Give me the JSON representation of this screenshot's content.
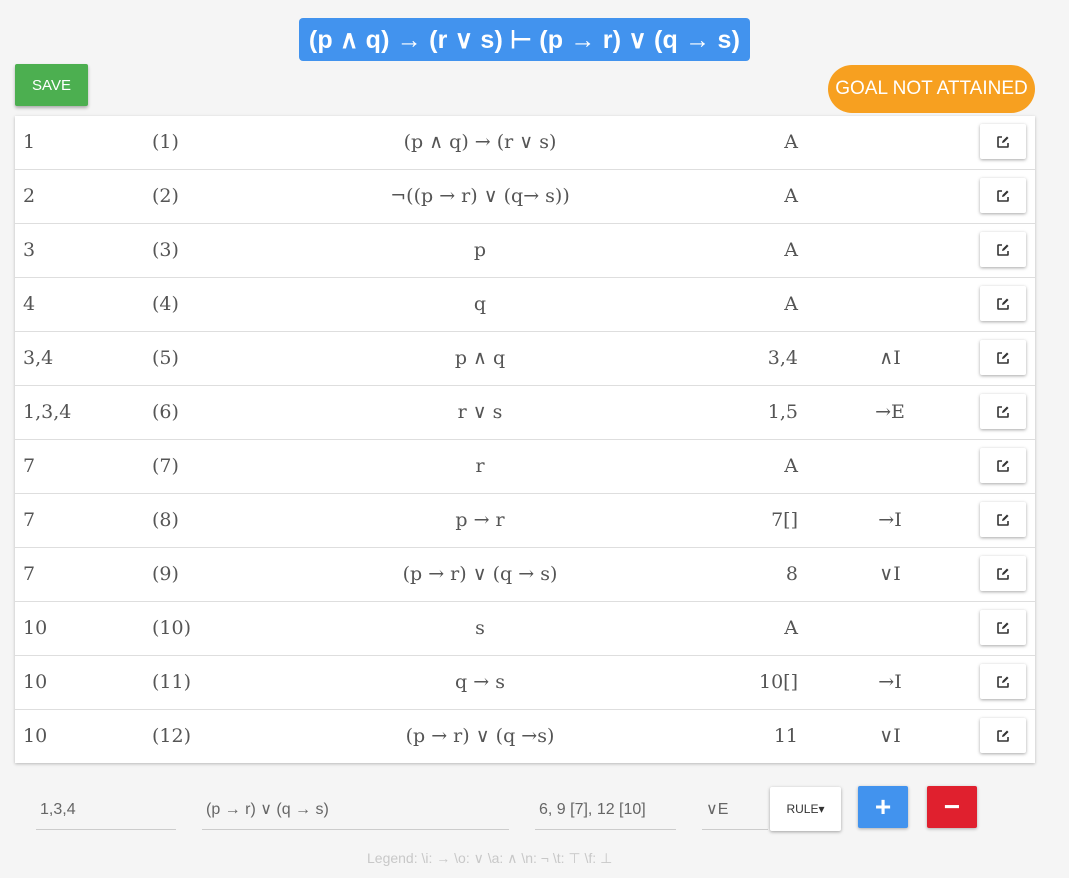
{
  "goal": {
    "sequent": "(p ∧ q) → (r ∨ s) ⊢ (p → r) ∨ (q → s)"
  },
  "toolbar": {
    "save_label": "SAVE"
  },
  "status": {
    "label": "GOAL NOT ATTAINED"
  },
  "colors": {
    "goal_bar": "#4293ee",
    "save": "#4caf50",
    "status": "#f7a020",
    "add": "#4293ee",
    "remove": "#e0202e"
  },
  "proof": {
    "rows": [
      {
        "deps": "1",
        "num": "(1)",
        "formula": "(p ∧ q) → (r ∨ s)",
        "cites": "A",
        "rule": ""
      },
      {
        "deps": "2",
        "num": "(2)",
        "formula": "¬((p → r) ∨ (q→ s))",
        "cites": "A",
        "rule": ""
      },
      {
        "deps": "3",
        "num": "(3)",
        "formula": "p",
        "cites": "A",
        "rule": ""
      },
      {
        "deps": "4",
        "num": "(4)",
        "formula": "q",
        "cites": "A",
        "rule": ""
      },
      {
        "deps": "3,4",
        "num": "(5)",
        "formula": "p ∧ q",
        "cites": "3,4",
        "rule": "∧I"
      },
      {
        "deps": "1,3,4",
        "num": "(6)",
        "formula": "r ∨ s",
        "cites": "1,5",
        "rule": "→E"
      },
      {
        "deps": "7",
        "num": "(7)",
        "formula": "r",
        "cites": "A",
        "rule": ""
      },
      {
        "deps": "7",
        "num": "(8)",
        "formula": "p → r",
        "cites": "7[]",
        "rule": "→I"
      },
      {
        "deps": "7",
        "num": "(9)",
        "formula": "(p → r) ∨ (q → s)",
        "cites": "8",
        "rule": "∨I"
      },
      {
        "deps": "10",
        "num": "(10)",
        "formula": "s",
        "cites": "A",
        "rule": ""
      },
      {
        "deps": "10",
        "num": "(11)",
        "formula": "q → s",
        "cites": "10[]",
        "rule": "→I"
      },
      {
        "deps": "10",
        "num": "(12)",
        "formula": "(p → r) ∨ (q →s)",
        "cites": "11",
        "rule": "∨I"
      }
    ],
    "edit_icon": "edit-icon"
  },
  "entry": {
    "deps": "1,3,4",
    "formula": "(p → r) ∨ (q → s)",
    "cites": "6, 9 [7], 12 [10]",
    "rule": "∨E",
    "rule_button_label": "RULE▾",
    "add_label": "+",
    "remove_label": "−"
  },
  "legend": {
    "text": "Legend:  \\i: →   \\o: ∨   \\a: ∧   \\n: ¬   \\t: ⊤   \\f: ⊥"
  }
}
